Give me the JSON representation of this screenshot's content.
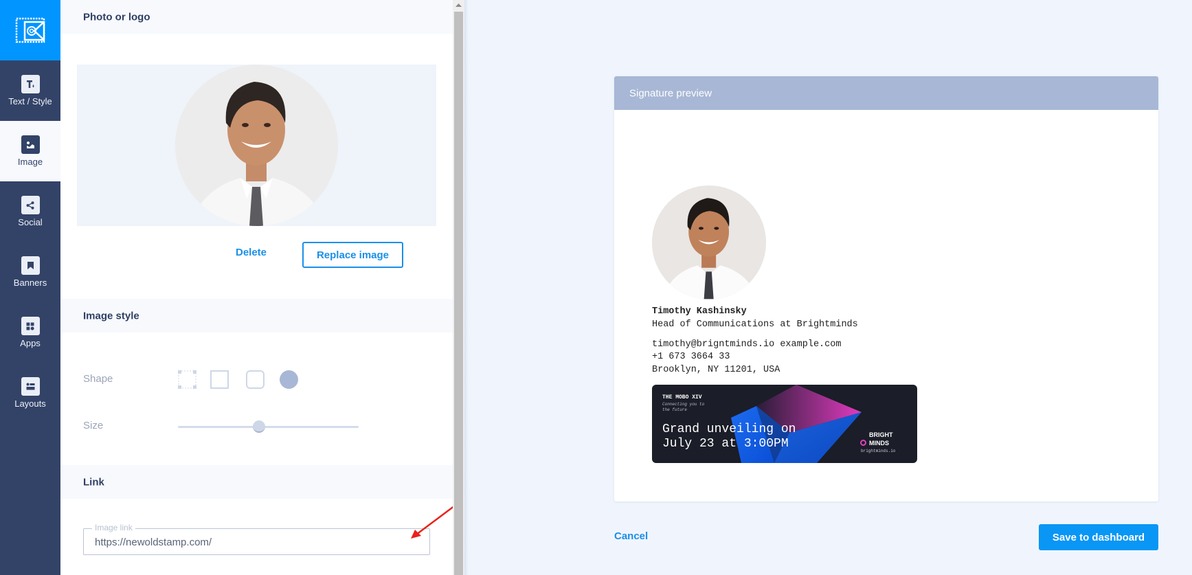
{
  "sidebar": {
    "logo_icon": "stamp-envelope-icon",
    "items": [
      {
        "label": "Text / Style",
        "icon": "text-style-icon",
        "active": false
      },
      {
        "label": "Image",
        "icon": "image-icon",
        "active": true
      },
      {
        "label": "Social",
        "icon": "share-icon",
        "active": false
      },
      {
        "label": "Banners",
        "icon": "bookmark-icon",
        "active": false
      },
      {
        "label": "Apps",
        "icon": "apps-grid-icon",
        "active": false
      },
      {
        "label": "Layouts",
        "icon": "layout-icon",
        "active": false
      }
    ]
  },
  "editor": {
    "photo_section": {
      "title": "Photo or logo",
      "delete_label": "Delete",
      "replace_label": "Replace image"
    },
    "style_section": {
      "title": "Image style",
      "shape_label": "Shape",
      "shapes": [
        {
          "name": "no-crop",
          "selected": false
        },
        {
          "name": "square",
          "selected": false
        },
        {
          "name": "rounded",
          "selected": false
        },
        {
          "name": "circle",
          "selected": true
        }
      ],
      "size_label": "Size",
      "size_value_percent": 45
    },
    "link_section": {
      "title": "Link",
      "field_label": "Image link",
      "field_value": "https://newoldstamp.com/"
    }
  },
  "preview": {
    "title": "Signature preview",
    "name": "Timothy Kashinsky",
    "position": "Head of Communications at Brightminds",
    "email_line": "timothy@brigntminds.io example.com",
    "phone": "+1 673 3664 33",
    "address": "Brooklyn, NY 11201, USA",
    "banner": {
      "event": "THE MOBO XIV",
      "tagline": "Connecting you to the future",
      "headline_1": "Grand unveiling on",
      "headline_2": "July 23 at 3:00PM",
      "brand_1": "BRIGHT",
      "brand_2": "MINDS",
      "brand_url": "brightminds.io"
    }
  },
  "actions": {
    "cancel_label": "Cancel",
    "save_label": "Save to dashboard"
  },
  "colors": {
    "accent": "#0a96f5",
    "sidebar_bg": "#334368",
    "preview_header": "#a7b7d5",
    "annotation_arrow": "#e8231c"
  }
}
